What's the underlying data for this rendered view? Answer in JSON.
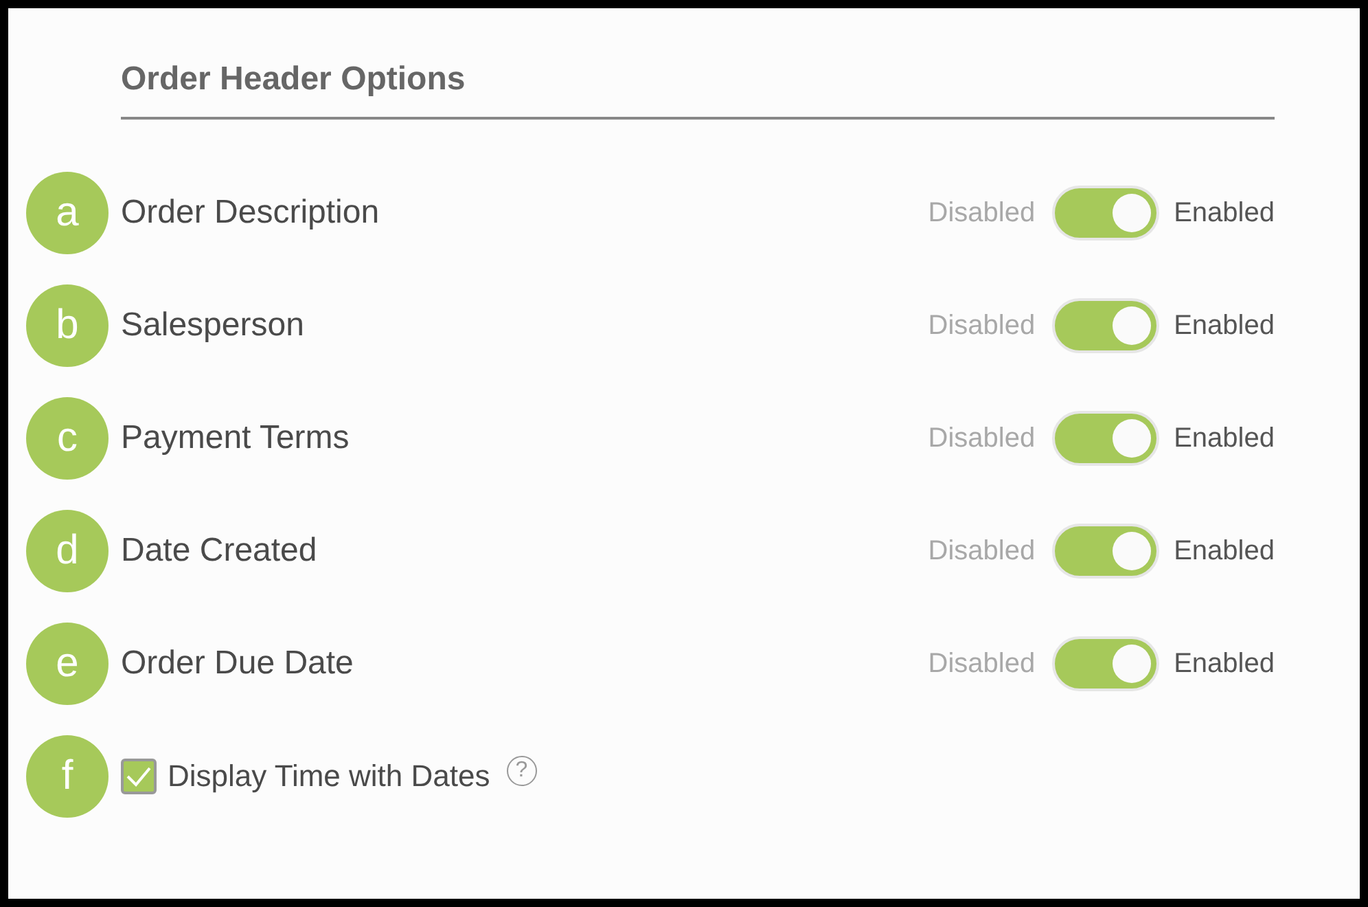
{
  "section": {
    "title": "Order Header Options"
  },
  "rows": [
    {
      "kind": "toggle",
      "marker": "a",
      "label": "Order Description",
      "off_label": "Disabled",
      "on_label": "Enabled",
      "on": true
    },
    {
      "kind": "toggle",
      "marker": "b",
      "label": "Salesperson",
      "off_label": "Disabled",
      "on_label": "Enabled",
      "on": true
    },
    {
      "kind": "toggle",
      "marker": "c",
      "label": "Payment Terms",
      "off_label": "Disabled",
      "on_label": "Enabled",
      "on": true
    },
    {
      "kind": "toggle",
      "marker": "d",
      "label": "Date Created",
      "off_label": "Disabled",
      "on_label": "Enabled",
      "on": true
    },
    {
      "kind": "toggle",
      "marker": "e",
      "label": "Order Due Date",
      "off_label": "Disabled",
      "on_label": "Enabled",
      "on": true
    },
    {
      "kind": "checkbox",
      "marker": "f",
      "label": "Display Time with Dates",
      "checked": true,
      "help": "?"
    }
  ]
}
